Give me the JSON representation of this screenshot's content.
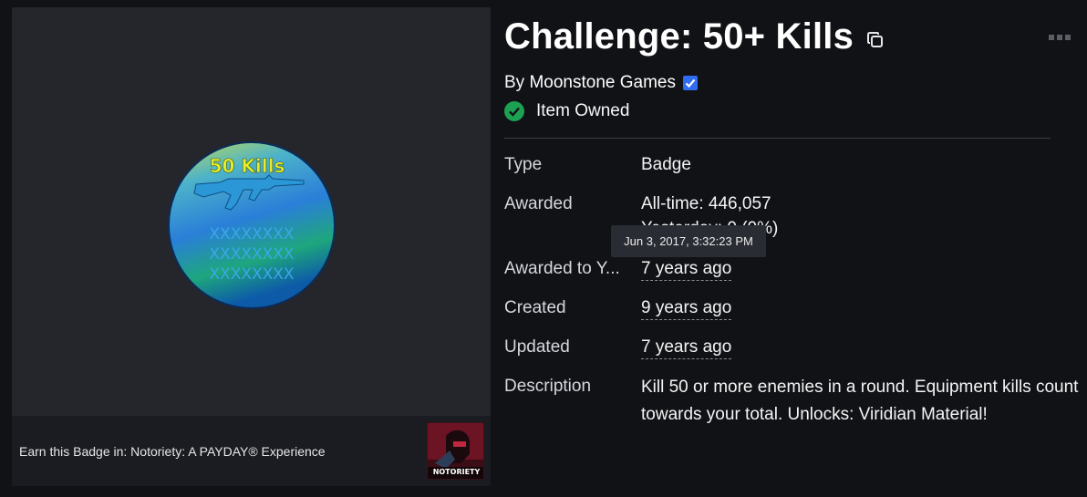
{
  "item": {
    "title": "Challenge: 50+ Kills",
    "creator_prefix": "By",
    "creator_name": "Moonstone Games",
    "owned_status": "Item Owned"
  },
  "badge_image": {
    "top_text": "50 Kills",
    "pattern_text": "XXXXXXXX"
  },
  "earn": {
    "text": "Earn this Badge in: Notoriety: A PAYDAY® Experience",
    "game_thumb_label": "NOTORIETY"
  },
  "details": {
    "type_label": "Type",
    "type_value": "Badge",
    "awarded_label": "Awarded",
    "awarded_alltime": "All-time: 446,057",
    "awarded_yesterday": "Yesterday: 0 (0%)",
    "awarded_to_you_label": "Awarded to Y...",
    "awarded_to_you_value": "7 years ago",
    "created_label": "Created",
    "created_value": "9 years ago",
    "updated_label": "Updated",
    "updated_value": "7 years ago",
    "description_label": "Description",
    "description_value": "Kill 50 or more enemies in a round. Equipment kills count towards your total. Unlocks: Viridian Material!"
  },
  "tooltip": {
    "text": "Jun 3, 2017, 3:32:23 PM"
  },
  "colors": {
    "background": "#111216",
    "panel": "#24262c",
    "verified": "#2f6bf3",
    "owned": "#1da052"
  }
}
